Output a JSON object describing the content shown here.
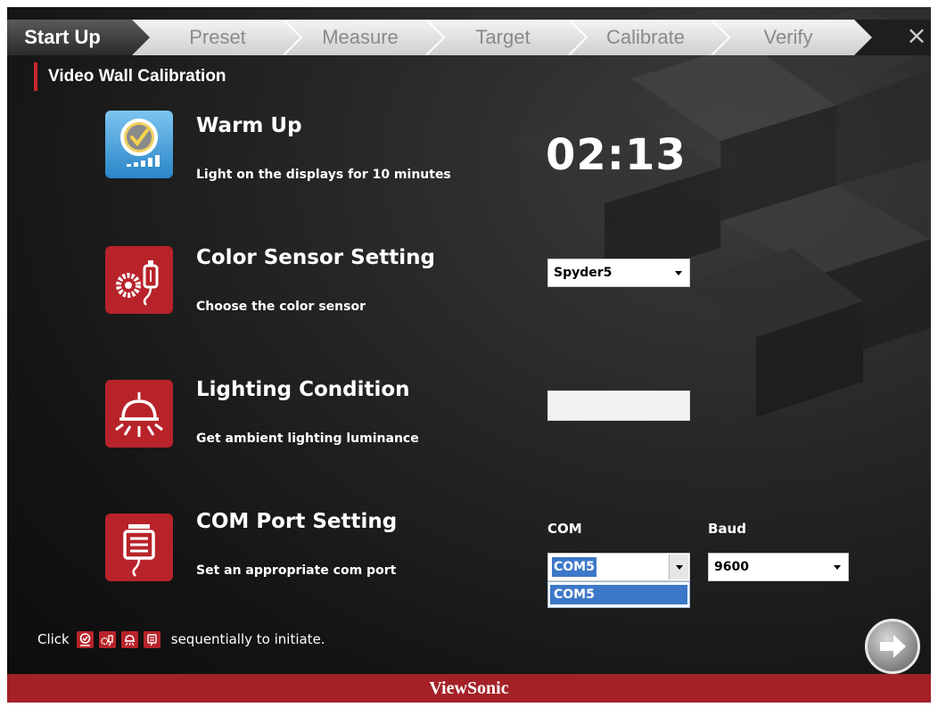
{
  "steps": [
    {
      "label": "Start Up",
      "active": true
    },
    {
      "label": "Preset",
      "active": false
    },
    {
      "label": "Measure",
      "active": false
    },
    {
      "label": "Target",
      "active": false
    },
    {
      "label": "Calibrate",
      "active": false
    },
    {
      "label": "Verify",
      "active": false
    }
  ],
  "close_label": "×",
  "page_title": "Video Wall Calibration",
  "warmup": {
    "title": "Warm Up",
    "description": "Light on the displays for 10 minutes",
    "timer": "02:13"
  },
  "sensor": {
    "title": "Color Sensor Setting",
    "description": "Choose the color sensor",
    "selected": "Spyder5"
  },
  "lighting": {
    "title": "Lighting Condition",
    "description": "Get ambient lighting luminance",
    "value": ""
  },
  "com_port": {
    "title": "COM Port Setting",
    "description": "Set an appropriate com port",
    "com_label": "COM",
    "com_selected": "COM5",
    "com_options": [
      "COM5"
    ],
    "baud_label": "Baud",
    "baud_selected": "9600"
  },
  "hint": {
    "prefix": "Click",
    "suffix": "sequentially to initiate."
  },
  "footer_brand": "ViewSonic",
  "colors": {
    "accent_red": "#a32127",
    "icon_blue": "#4a9fd8",
    "icon_red": "#b8232a",
    "highlight_blue": "#3c78c8"
  },
  "icons": {
    "warmup": "clock-display-icon",
    "sensor": "sensor-usb-icon",
    "lighting": "lamp-icon",
    "com_port": "serial-port-icon",
    "next": "arrow-right-icon",
    "close": "close-icon"
  }
}
